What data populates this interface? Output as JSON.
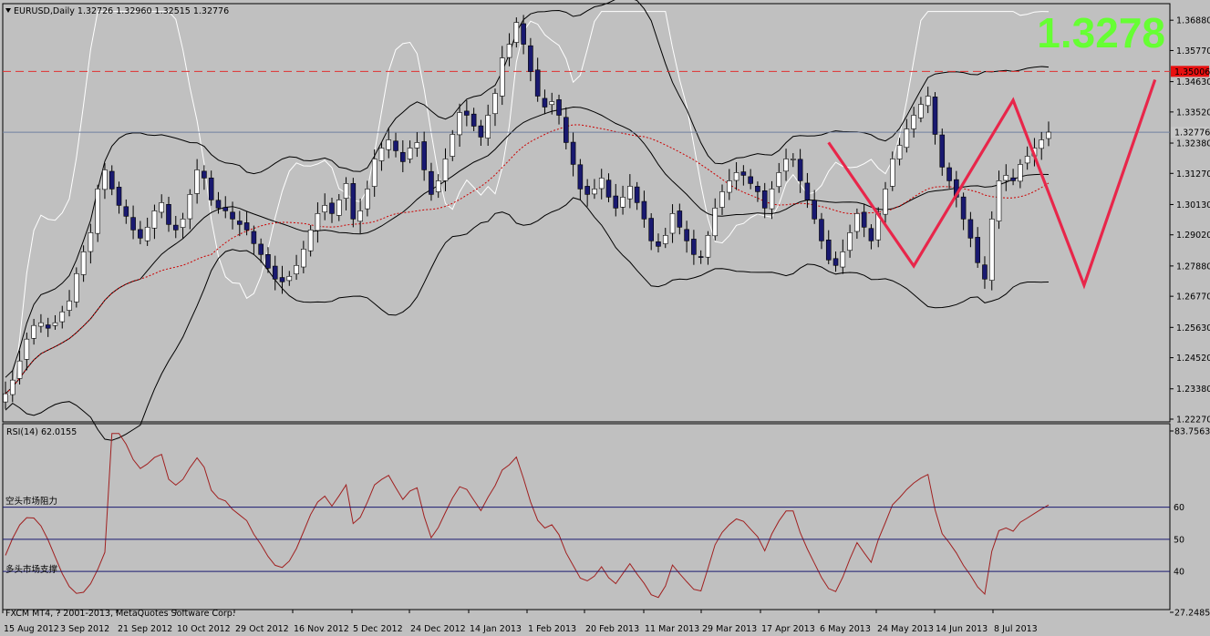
{
  "header": {
    "dropdown_icon": "triangle-down-icon",
    "symbol_info": "EURUSD,Daily  1.32726 1.32960 1.32515 1.32776"
  },
  "big_price": {
    "text": "1.3278",
    "color": "#66ff33"
  },
  "colors": {
    "background": "#c0c0c0",
    "bull_candle": "#ffffff",
    "bear_candle": "#191970",
    "bands": "#000000",
    "white_line": "#ffffff",
    "ma_dotted": "#cc0000",
    "resistance": "#e03030",
    "pattern": "#e8264a",
    "rsi_line": "#a02020",
    "rsi_levels": "#191970",
    "price_marker": "#e81010",
    "current_marker": "#c8c8c8"
  },
  "chart_data": [
    {
      "type": "candlestick",
      "title": "EURUSD,Daily",
      "ohlc_last": {
        "open": 1.32726,
        "high": 1.3296,
        "low": 1.32515,
        "close": 1.32776
      },
      "ylim": [
        1.2227,
        1.3742
      ],
      "y_ticks": [
        "1.36880",
        "1.35770",
        "1.34630",
        "1.33520",
        "1.32380",
        "1.31270",
        "1.30130",
        "1.29020",
        "1.27880",
        "1.26770",
        "1.25630",
        "1.24520",
        "1.23380",
        "1.22270"
      ],
      "x_labels": [
        "15 Aug 2012",
        "3 Sep 2012",
        "21 Sep 2012",
        "10 Oct 2012",
        "29 Oct 2012",
        "16 Nov 2012",
        "5 Dec 2012",
        "24 Dec 2012",
        "14 Jan 2013",
        "1 Feb 2013",
        "20 Feb 2013",
        "11 Mar 2013",
        "29 Mar 2013",
        "17 Apr 2013",
        "6 May 2013",
        "24 May 2013",
        "14 Jun 2013",
        "8 Jul 2013"
      ],
      "closes": [
        1.232,
        1.237,
        1.244,
        1.252,
        1.257,
        1.258,
        1.256,
        1.258,
        1.262,
        1.266,
        1.276,
        1.284,
        1.291,
        1.307,
        1.314,
        1.307,
        1.301,
        1.297,
        1.292,
        1.289,
        1.293,
        1.299,
        1.302,
        1.294,
        1.292,
        1.296,
        1.305,
        1.314,
        1.311,
        1.303,
        1.3,
        1.299,
        1.296,
        1.294,
        1.292,
        1.287,
        1.283,
        1.278,
        1.274,
        1.273,
        1.275,
        1.279,
        1.285,
        1.292,
        1.298,
        1.301,
        1.298,
        1.303,
        1.309,
        1.296,
        1.299,
        1.307,
        1.318,
        1.322,
        1.325,
        1.321,
        1.317,
        1.322,
        1.324,
        1.314,
        1.305,
        1.31,
        1.318,
        1.327,
        1.335,
        1.334,
        1.33,
        1.326,
        1.334,
        1.342,
        1.355,
        1.36,
        1.368,
        1.36,
        1.35,
        1.341,
        1.337,
        1.339,
        1.334,
        1.324,
        1.316,
        1.307,
        1.305,
        1.307,
        1.311,
        1.304,
        1.3,
        1.304,
        1.308,
        1.302,
        1.296,
        1.288,
        1.286,
        1.29,
        1.298,
        1.293,
        1.288,
        1.283,
        1.282,
        1.29,
        1.3,
        1.306,
        1.31,
        1.313,
        1.312,
        1.309,
        1.306,
        1.3,
        1.307,
        1.313,
        1.318,
        1.318,
        1.31,
        1.303,
        1.296,
        1.288,
        1.281,
        1.279,
        1.284,
        1.291,
        1.298,
        1.293,
        1.288,
        1.298,
        1.307,
        1.318,
        1.323,
        1.329,
        1.334,
        1.338,
        1.341,
        1.327,
        1.315,
        1.31,
        1.304,
        1.296,
        1.289,
        1.28,
        1.274,
        1.296,
        1.31,
        1.312,
        1.31,
        1.316,
        1.319,
        1.322,
        1.325,
        1.3278
      ],
      "resistance_level": {
        "value": 1.35006,
        "label": "1.35006"
      },
      "current_level": {
        "value": 1.32776,
        "label": "1.32776"
      },
      "pattern_points": [
        [
          116,
          1.324
        ],
        [
          128,
          1.2788
        ],
        [
          142,
          1.3395
        ],
        [
          152,
          1.2718
        ],
        [
          162,
          1.347
        ]
      ]
    },
    {
      "type": "line",
      "title": "RSI(14) 62.0155",
      "ylim": [
        27.2485,
        83.7563
      ],
      "y_ticks": [
        "83.7563",
        "27.2485"
      ],
      "levels": [
        {
          "value": 60,
          "label": "60",
          "text": "空头市场阻力"
        },
        {
          "value": 50,
          "label": "50",
          "text": ""
        },
        {
          "value": 40,
          "label": "40",
          "text": "多头市场支撑"
        }
      ],
      "footer": "FXCM MT4, ? 2001-2013, MetaQuotes Software Corp."
    }
  ]
}
